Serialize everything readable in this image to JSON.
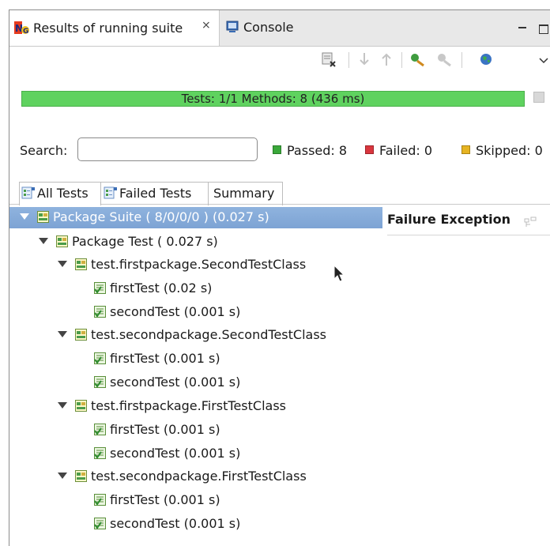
{
  "tabs": {
    "results_label": "Results of running suite",
    "console_label": "Console"
  },
  "progress": {
    "text": "Tests: 1/1  Methods: 8 (436 ms)",
    "fraction": 1.0
  },
  "search": {
    "label": "Search:",
    "value": ""
  },
  "stats": {
    "passed": "Passed: 8",
    "failed": "Failed: 0",
    "skipped": "Skipped: 0"
  },
  "subtabs": {
    "all": "All Tests",
    "failed": "Failed Tests",
    "summary": "Summary"
  },
  "failure_panel": {
    "title": "Failure Exception"
  },
  "tree": {
    "suite": "Package Suite ( 8/0/0/0 ) (0.027 s)",
    "test": "Package Test ( 0.027 s)",
    "classes": [
      {
        "name": "test.firstpackage.SecondTestClass",
        "methods": [
          "firstTest  (0.02 s)",
          "secondTest  (0.001 s)"
        ]
      },
      {
        "name": "test.secondpackage.SecondTestClass",
        "methods": [
          "firstTest  (0.001 s)",
          "secondTest  (0.001 s)"
        ]
      },
      {
        "name": "test.firstpackage.FirstTestClass",
        "methods": [
          "firstTest  (0.001 s)",
          "secondTest  (0.001 s)"
        ]
      },
      {
        "name": "test.secondpackage.FirstTestClass",
        "methods": [
          "firstTest  (0.001 s)",
          "secondTest  (0.001 s)"
        ]
      }
    ]
  },
  "colors": {
    "progress_green": "#5fd25f",
    "selection_blue": "#8fb3de",
    "passed": "#3aa83a",
    "failed": "#d9363e",
    "skipped": "#e6b422"
  },
  "icons": {
    "results_tab": "testng-icon",
    "console_tab": "console-icon"
  }
}
